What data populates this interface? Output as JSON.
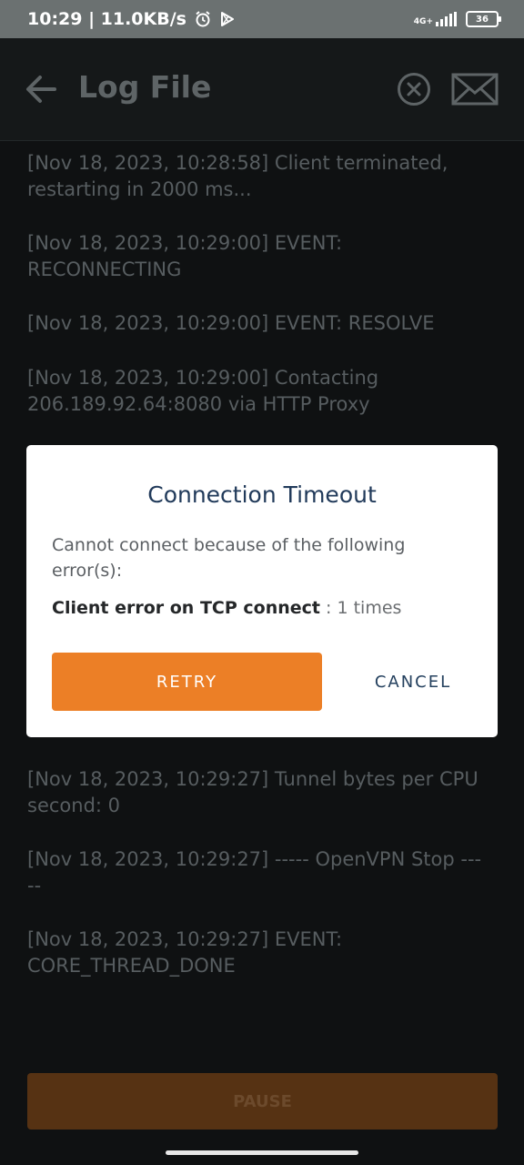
{
  "status_bar": {
    "time_speed": "10:29 | 11.0KB/s",
    "network": "4G+",
    "battery": "36",
    "icons": [
      "alarm-icon",
      "play-store-icon",
      "signal-icon",
      "battery-icon"
    ]
  },
  "app_bar": {
    "title": "Log File",
    "icons": [
      "back-arrow-icon",
      "close-circle-icon",
      "mail-icon"
    ]
  },
  "log_top": [
    "[Nov 18, 2023, 10:28:58] Client terminated, restarting in 2000 ms...",
    "[Nov 18, 2023, 10:29:00] EVENT: RECONNECTING",
    "[Nov 18, 2023, 10:29:00] EVENT: RESOLVE",
    "[Nov 18, 2023, 10:29:00] Contacting 206.189.92.64:8080 via HTTP Proxy"
  ],
  "log_bottom": [
    "[Nov 18, 2023, 10:29:27] Tunnel bytes per CPU second: 0",
    "[Nov 18, 2023, 10:29:27] ----- OpenVPN Stop -----",
    "[Nov 18, 2023, 10:29:27] EVENT: CORE_THREAD_DONE"
  ],
  "dialog": {
    "title": "Connection Timeout",
    "message": "Cannot connect because of the following error(s):",
    "error_label": "Client error on TCP connect",
    "error_count": " : 1 times",
    "retry_label": "RETRY",
    "cancel_label": "CANCEL"
  },
  "pause_label": "PAUSE",
  "colors": {
    "accent": "#ec7f26",
    "dialog_title": "#213a5a",
    "background": "#0f1112"
  }
}
